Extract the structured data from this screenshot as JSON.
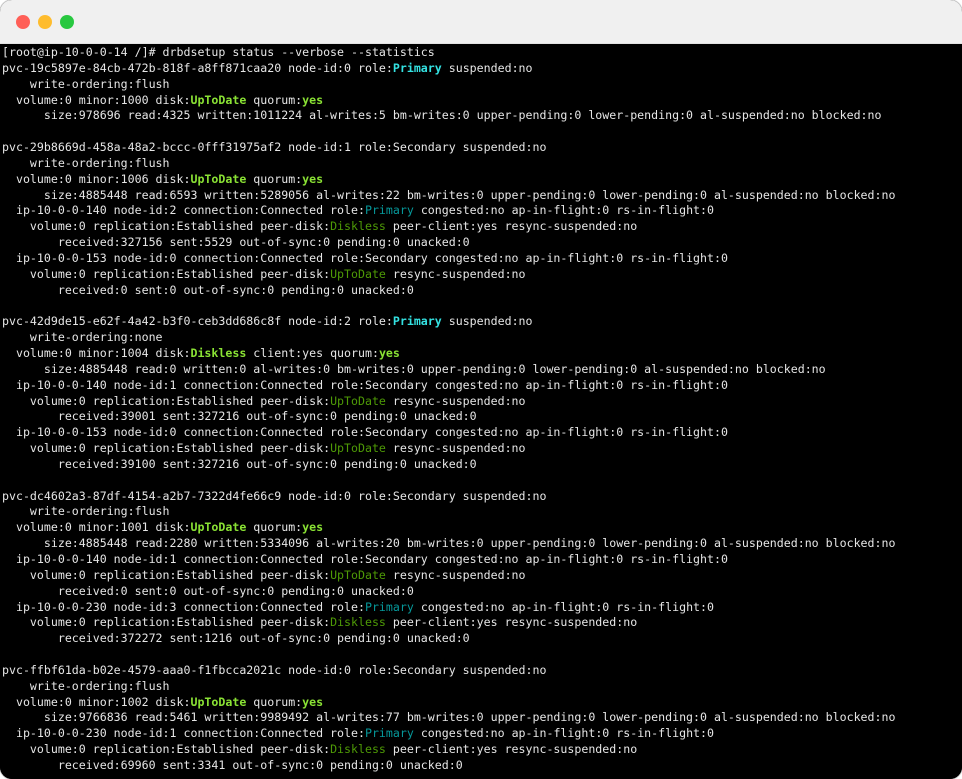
{
  "window": {
    "controls": [
      "close",
      "minimize",
      "maximize"
    ]
  },
  "colors": {
    "close": "#ff5f57",
    "minimize": "#febc2e",
    "maximize": "#28c840",
    "highlight_green": "#8ae234",
    "highlight_cyan": "#34e2e2"
  },
  "terminal": {
    "lines": [
      [
        [
          "p",
          "[root@ip-10-0-0-14 /]# drbdsetup status --verbose --statistics"
        ]
      ],
      [
        [
          "p",
          "pvc-19c5897e-84cb-472b-818f-a8ff871caa20 node-id:0 role:"
        ],
        [
          "c",
          "Primary"
        ],
        [
          "p",
          " suspended:no"
        ]
      ],
      [
        [
          "p",
          "    write-ordering:flush"
        ]
      ],
      [
        [
          "p",
          "  volume:0 minor:1000 disk:"
        ],
        [
          "g",
          "UpToDate"
        ],
        [
          "p",
          " quorum:"
        ],
        [
          "g",
          "yes"
        ]
      ],
      [
        [
          "p",
          "      size:978696 read:4325 written:1011224 al-writes:5 bm-writes:0 upper-pending:0 lower-pending:0 al-suspended:no blocked:no"
        ]
      ],
      [
        [
          "p",
          ""
        ]
      ],
      [
        [
          "p",
          "pvc-29b8669d-458a-48a2-bccc-0fff31975af2 node-id:1 role:Secondary suspended:no"
        ]
      ],
      [
        [
          "p",
          "    write-ordering:flush"
        ]
      ],
      [
        [
          "p",
          "  volume:0 minor:1006 disk:"
        ],
        [
          "g",
          "UpToDate"
        ],
        [
          "p",
          " quorum:"
        ],
        [
          "g",
          "yes"
        ]
      ],
      [
        [
          "p",
          "      size:4885448 read:6593 written:5289056 al-writes:22 bm-writes:0 upper-pending:0 lower-pending:0 al-suspended:no blocked:no"
        ]
      ],
      [
        [
          "p",
          "  ip-10-0-0-140 node-id:2 connection:Connected role:"
        ],
        [
          "cn",
          "Primary"
        ],
        [
          "p",
          " congested:no ap-in-flight:0 rs-in-flight:0"
        ]
      ],
      [
        [
          "p",
          "    volume:0 replication:Established peer-disk:"
        ],
        [
          "gn",
          "Diskless"
        ],
        [
          "p",
          " peer-client:yes resync-suspended:no"
        ]
      ],
      [
        [
          "p",
          "        received:327156 sent:5529 out-of-sync:0 pending:0 unacked:0"
        ]
      ],
      [
        [
          "p",
          "  ip-10-0-0-153 node-id:0 connection:Connected role:Secondary congested:no ap-in-flight:0 rs-in-flight:0"
        ]
      ],
      [
        [
          "p",
          "    volume:0 replication:Established peer-disk:"
        ],
        [
          "gn",
          "UpToDate"
        ],
        [
          "p",
          " resync-suspended:no"
        ]
      ],
      [
        [
          "p",
          "        received:0 sent:0 out-of-sync:0 pending:0 unacked:0"
        ]
      ],
      [
        [
          "p",
          ""
        ]
      ],
      [
        [
          "p",
          "pvc-42d9de15-e62f-4a42-b3f0-ceb3dd686c8f node-id:2 role:"
        ],
        [
          "c",
          "Primary"
        ],
        [
          "p",
          " suspended:no"
        ]
      ],
      [
        [
          "p",
          "    write-ordering:none"
        ]
      ],
      [
        [
          "p",
          "  volume:0 minor:1004 disk:"
        ],
        [
          "g",
          "Diskless"
        ],
        [
          "p",
          " client:yes quorum:"
        ],
        [
          "g",
          "yes"
        ]
      ],
      [
        [
          "p",
          "      size:4885448 read:0 written:0 al-writes:0 bm-writes:0 upper-pending:0 lower-pending:0 al-suspended:no blocked:no"
        ]
      ],
      [
        [
          "p",
          "  ip-10-0-0-140 node-id:1 connection:Connected role:Secondary congested:no ap-in-flight:0 rs-in-flight:0"
        ]
      ],
      [
        [
          "p",
          "    volume:0 replication:Established peer-disk:"
        ],
        [
          "gn",
          "UpToDate"
        ],
        [
          "p",
          " resync-suspended:no"
        ]
      ],
      [
        [
          "p",
          "        received:39001 sent:327216 out-of-sync:0 pending:0 unacked:0"
        ]
      ],
      [
        [
          "p",
          "  ip-10-0-0-153 node-id:0 connection:Connected role:Secondary congested:no ap-in-flight:0 rs-in-flight:0"
        ]
      ],
      [
        [
          "p",
          "    volume:0 replication:Established peer-disk:"
        ],
        [
          "gn",
          "UpToDate"
        ],
        [
          "p",
          " resync-suspended:no"
        ]
      ],
      [
        [
          "p",
          "        received:39100 sent:327216 out-of-sync:0 pending:0 unacked:0"
        ]
      ],
      [
        [
          "p",
          ""
        ]
      ],
      [
        [
          "p",
          "pvc-dc4602a3-87df-4154-a2b7-7322d4fe66c9 node-id:0 role:Secondary suspended:no"
        ]
      ],
      [
        [
          "p",
          "    write-ordering:flush"
        ]
      ],
      [
        [
          "p",
          "  volume:0 minor:1001 disk:"
        ],
        [
          "g",
          "UpToDate"
        ],
        [
          "p",
          " quorum:"
        ],
        [
          "g",
          "yes"
        ]
      ],
      [
        [
          "p",
          "      size:4885448 read:2280 written:5334096 al-writes:20 bm-writes:0 upper-pending:0 lower-pending:0 al-suspended:no blocked:no"
        ]
      ],
      [
        [
          "p",
          "  ip-10-0-0-140 node-id:1 connection:Connected role:Secondary congested:no ap-in-flight:0 rs-in-flight:0"
        ]
      ],
      [
        [
          "p",
          "    volume:0 replication:Established peer-disk:"
        ],
        [
          "gn",
          "UpToDate"
        ],
        [
          "p",
          " resync-suspended:no"
        ]
      ],
      [
        [
          "p",
          "        received:0 sent:0 out-of-sync:0 pending:0 unacked:0"
        ]
      ],
      [
        [
          "p",
          "  ip-10-0-0-230 node-id:3 connection:Connected role:"
        ],
        [
          "cn",
          "Primary"
        ],
        [
          "p",
          " congested:no ap-in-flight:0 rs-in-flight:0"
        ]
      ],
      [
        [
          "p",
          "    volume:0 replication:Established peer-disk:"
        ],
        [
          "gn",
          "Diskless"
        ],
        [
          "p",
          " peer-client:yes resync-suspended:no"
        ]
      ],
      [
        [
          "p",
          "        received:372272 sent:1216 out-of-sync:0 pending:0 unacked:0"
        ]
      ],
      [
        [
          "p",
          ""
        ]
      ],
      [
        [
          "p",
          "pvc-ffbf61da-b02e-4579-aaa0-f1fbcca2021c node-id:0 role:Secondary suspended:no"
        ]
      ],
      [
        [
          "p",
          "    write-ordering:flush"
        ]
      ],
      [
        [
          "p",
          "  volume:0 minor:1002 disk:"
        ],
        [
          "g",
          "UpToDate"
        ],
        [
          "p",
          " quorum:"
        ],
        [
          "g",
          "yes"
        ]
      ],
      [
        [
          "p",
          "      size:9766836 read:5461 written:9989492 al-writes:77 bm-writes:0 upper-pending:0 lower-pending:0 al-suspended:no blocked:no"
        ]
      ],
      [
        [
          "p",
          "  ip-10-0-0-230 node-id:1 connection:Connected role:"
        ],
        [
          "cn",
          "Primary"
        ],
        [
          "p",
          " congested:no ap-in-flight:0 rs-in-flight:0"
        ]
      ],
      [
        [
          "p",
          "    volume:0 replication:Established peer-disk:"
        ],
        [
          "gn",
          "Diskless"
        ],
        [
          "p",
          " peer-client:yes resync-suspended:no"
        ]
      ],
      [
        [
          "p",
          "        received:69960 sent:3341 out-of-sync:0 pending:0 unacked:0"
        ]
      ]
    ]
  }
}
